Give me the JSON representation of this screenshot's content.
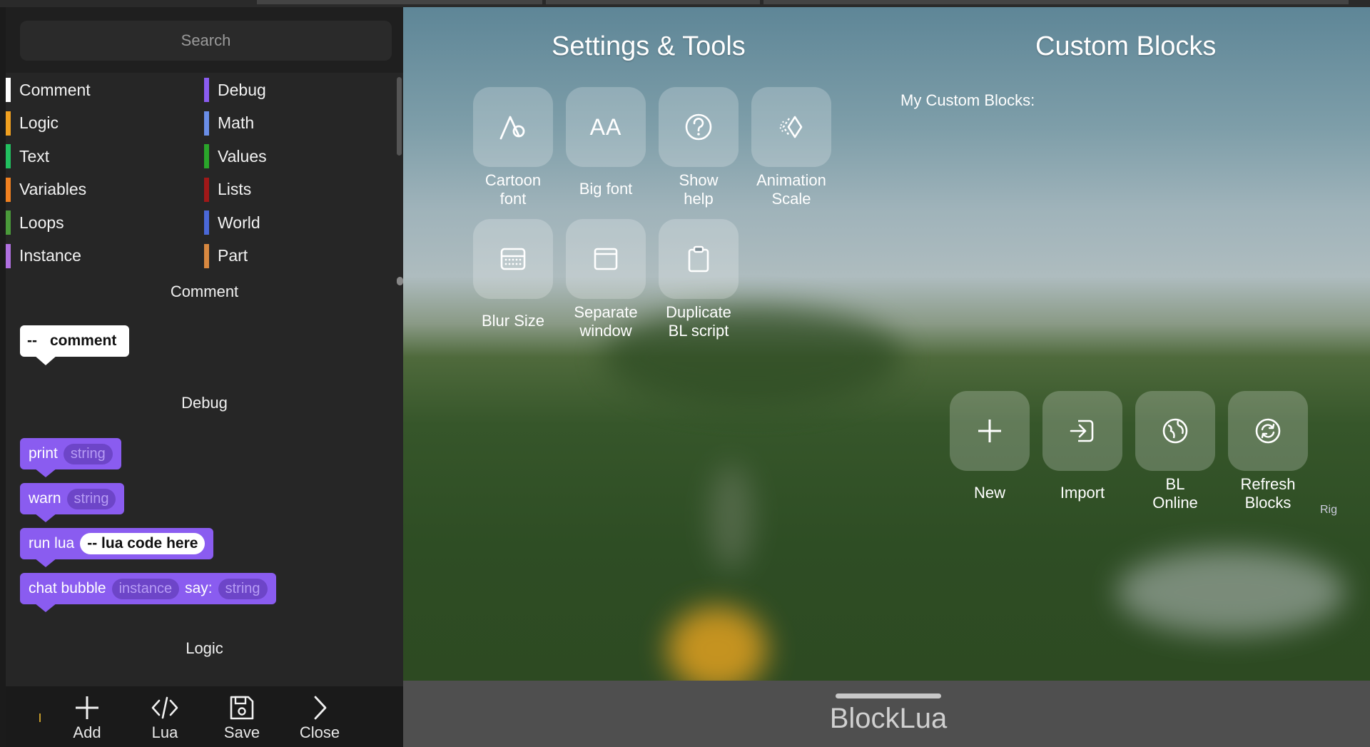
{
  "search": {
    "placeholder": "Search"
  },
  "categories": [
    {
      "label": "Comment",
      "color": "#ffffff"
    },
    {
      "label": "Debug",
      "color": "#8a5cf0"
    },
    {
      "label": "Logic",
      "color": "#f0a020"
    },
    {
      "label": "Math",
      "color": "#6a8ee8"
    },
    {
      "label": "Text",
      "color": "#22c060"
    },
    {
      "label": "Values",
      "color": "#2aa52a"
    },
    {
      "label": "Variables",
      "color": "#f08020"
    },
    {
      "label": "Lists",
      "color": "#a01818"
    },
    {
      "label": "Loops",
      "color": "#4a9a3a"
    },
    {
      "label": "World",
      "color": "#4a68d8"
    },
    {
      "label": "Instance",
      "color": "#b070e0"
    },
    {
      "label": "Part",
      "color": "#d88840"
    }
  ],
  "sections": {
    "comment": "Comment",
    "debug": "Debug",
    "logic": "Logic"
  },
  "blocks": {
    "comment": {
      "dash": "--",
      "word": "comment"
    },
    "print": {
      "label": "print",
      "arg": "string"
    },
    "warn": {
      "label": "warn",
      "arg": "string"
    },
    "runlua": {
      "label": "run lua",
      "arg": "-- lua code here"
    },
    "chat": {
      "label": "chat bubble",
      "arg1": "instance",
      "mid": "say:",
      "arg2": "string"
    }
  },
  "toolbar": {
    "add": "Add",
    "lua": "Lua",
    "save": "Save",
    "close": "Close"
  },
  "settings": {
    "title": "Settings & Tools",
    "tiles": [
      {
        "icon": "cartoon-font-icon",
        "label": "Cartoon\nfont"
      },
      {
        "icon": "big-font-icon",
        "label": "Big font",
        "glyph": "AA"
      },
      {
        "icon": "help-icon",
        "label": "Show\nhelp"
      },
      {
        "icon": "animation-scale-icon",
        "label": "Animation\nScale"
      },
      {
        "icon": "blur-icon",
        "label": "Blur Size"
      },
      {
        "icon": "window-icon",
        "label": "Separate\nwindow"
      },
      {
        "icon": "clipboard-icon",
        "label": "Duplicate\nBL script"
      }
    ]
  },
  "custom": {
    "title": "Custom Blocks",
    "mine": "My Custom Blocks:",
    "tiles": [
      {
        "icon": "plus-icon",
        "label": "New"
      },
      {
        "icon": "import-icon",
        "label": "Import"
      },
      {
        "icon": "globe-icon",
        "label": "BL\nOnline"
      },
      {
        "icon": "refresh-icon",
        "label": "Refresh\nBlocks"
      }
    ]
  },
  "rig": "Rig",
  "brand": "BlockLua"
}
